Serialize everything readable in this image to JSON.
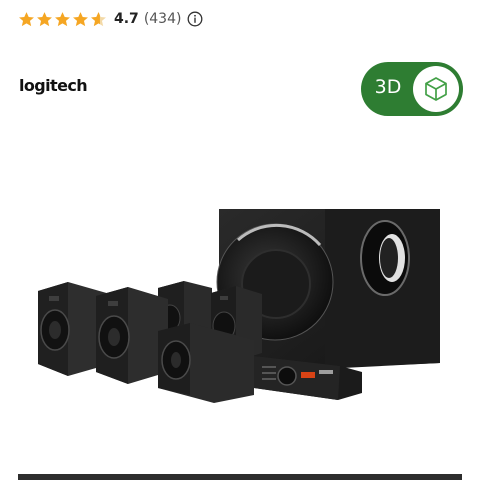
{
  "rating": {
    "stars": 4.7,
    "value": "4.7",
    "count": "(434)",
    "star_color": "#f5a623",
    "info_icon": "info-circle-icon"
  },
  "brand": {
    "logo_text": "logitech"
  },
  "view3d": {
    "label": "3D",
    "icon": "cube-3d-icon",
    "color": "#2e7d32"
  },
  "product": {
    "image_name": "logitech-5-1-surround-speaker-system"
  }
}
